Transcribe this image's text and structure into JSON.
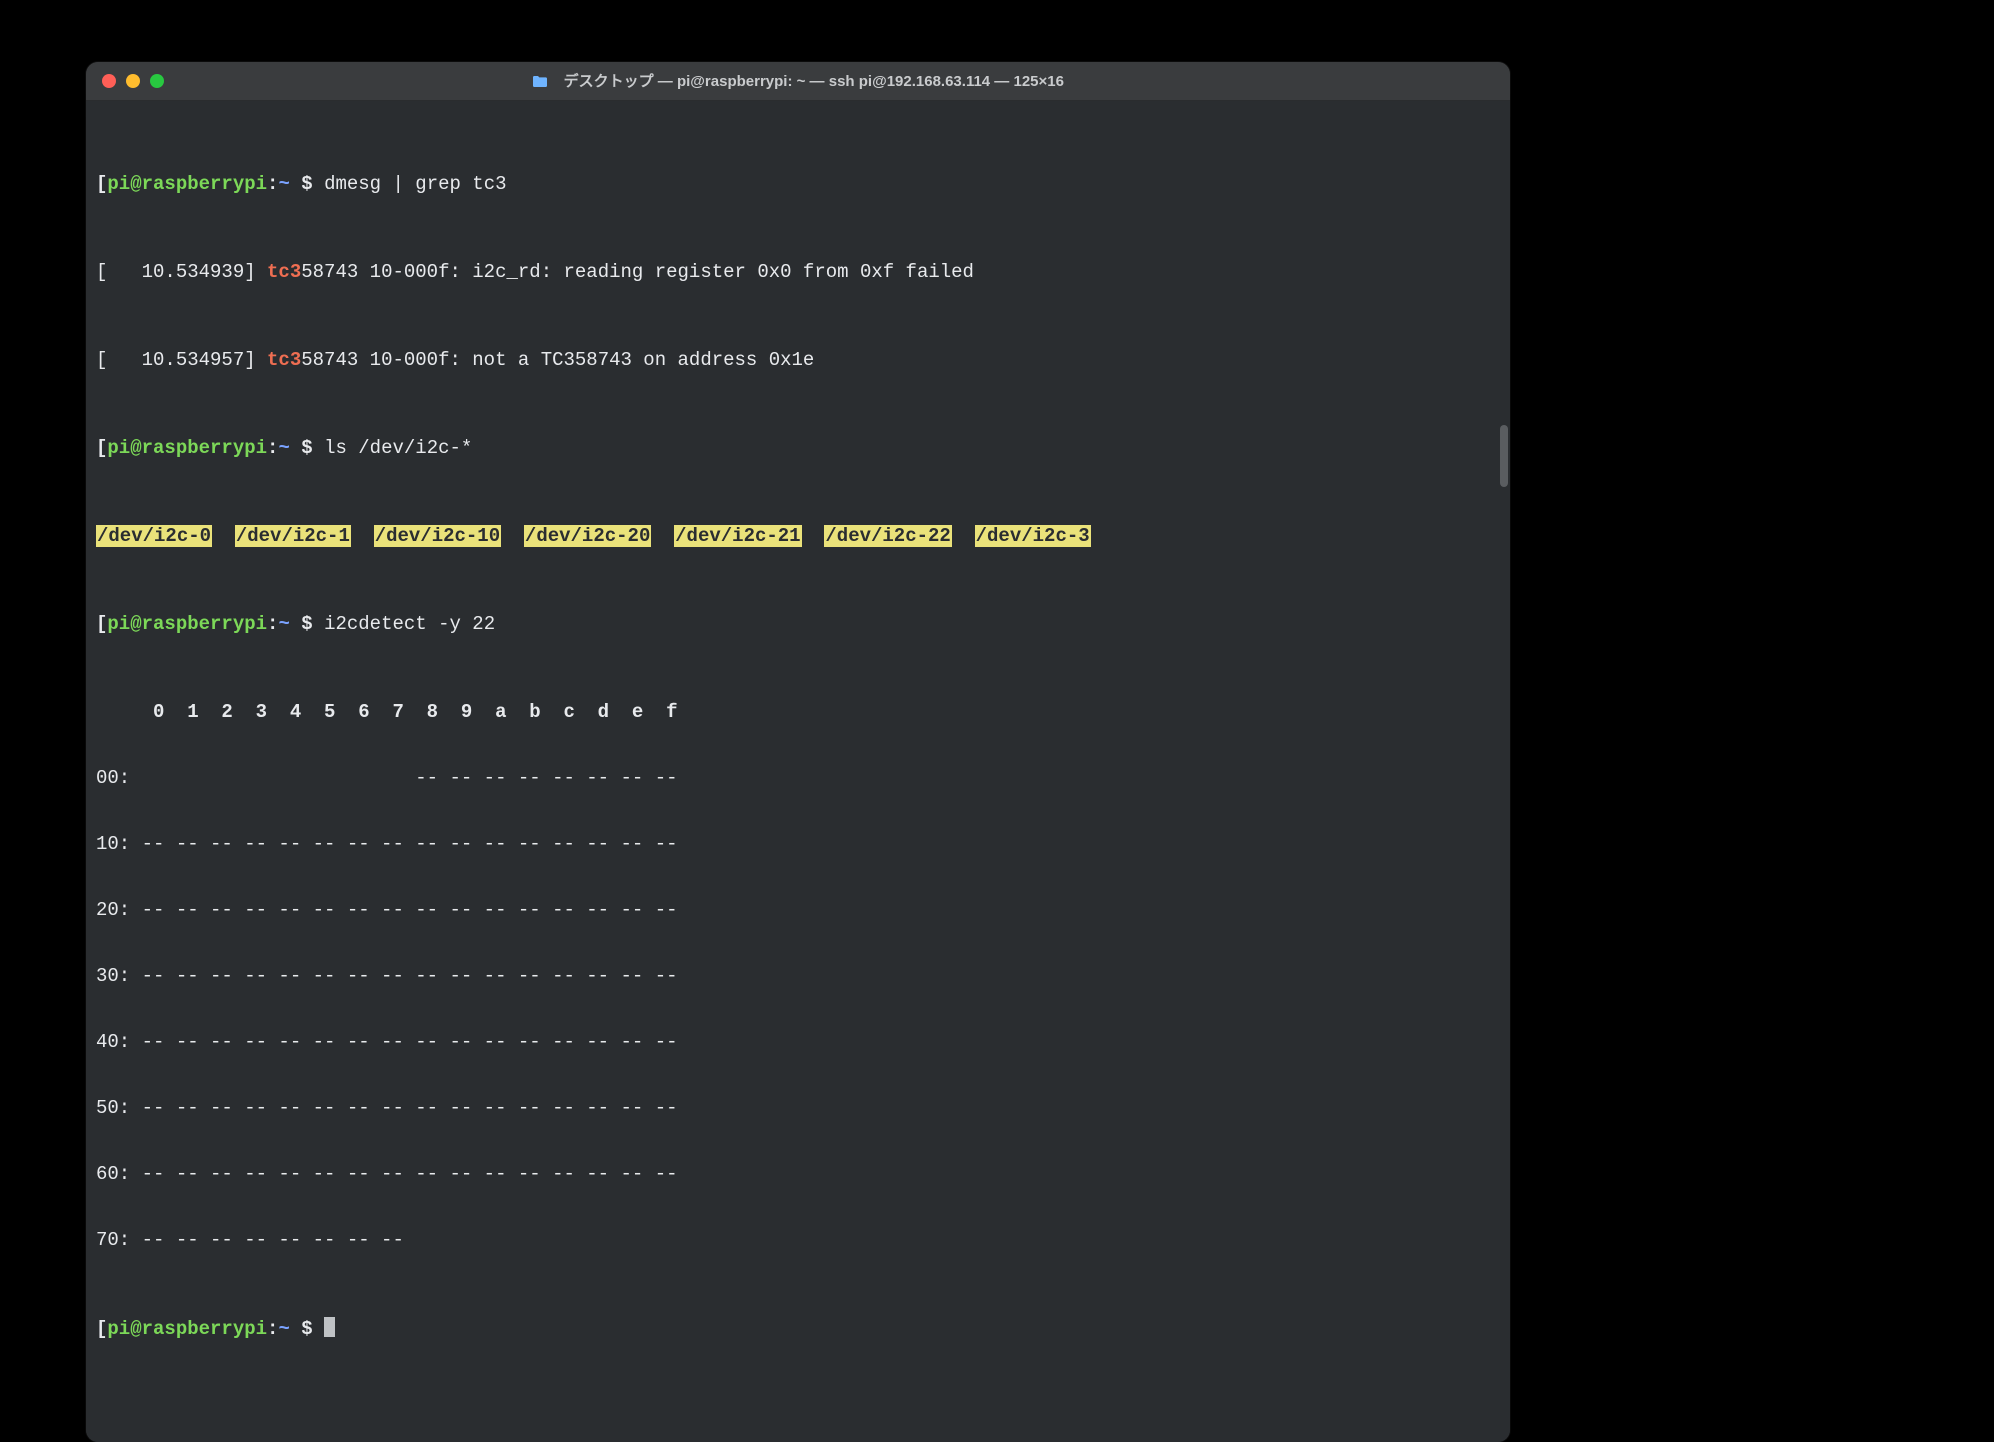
{
  "window": {
    "title": "デスクトップ — pi@raspberrypi: ~ — ssh pi@192.168.63.114 — 125×16"
  },
  "prompt": {
    "open": "[",
    "close": "]",
    "user_host": "pi@raspberrypi",
    "sep": ":",
    "path": "~",
    "dollar": " $ "
  },
  "commands": {
    "cmd1": "dmesg | grep tc3",
    "cmd2": "ls /dev/i2c-*",
    "cmd3": "i2cdetect -y 22"
  },
  "dmesg": {
    "l1_pre": "[   10.534939] ",
    "l1_tc": "tc3",
    "l1_rest": "58743 10-000f: i2c_rd: reading register 0x0 from 0xf failed",
    "l2_pre": "[   10.534957] ",
    "l2_tc": "tc3",
    "l2_rest": "58743 10-000f: not a TC358743 on address 0x1e"
  },
  "ls": {
    "d0": "/dev/i2c-0",
    "d1": "/dev/i2c-1",
    "d10": "/dev/i2c-10",
    "d20": "/dev/i2c-20",
    "d21": "/dev/i2c-21",
    "d22": "/dev/i2c-22",
    "d3": "/dev/i2c-3",
    "gap": "  "
  },
  "i2c": {
    "header": "     0  1  2  3  4  5  6  7  8  9  a  b  c  d  e  f",
    "r00": "00:                         -- -- -- -- -- -- -- -- ",
    "r10": "10: -- -- -- -- -- -- -- -- -- -- -- -- -- -- -- -- ",
    "r20": "20: -- -- -- -- -- -- -- -- -- -- -- -- -- -- -- -- ",
    "r30": "30: -- -- -- -- -- -- -- -- -- -- -- -- -- -- -- -- ",
    "r40": "40: -- -- -- -- -- -- -- -- -- -- -- -- -- -- -- -- ",
    "r50": "50: -- -- -- -- -- -- -- -- -- -- -- -- -- -- -- -- ",
    "r60": "60: -- -- -- -- -- -- -- -- -- -- -- -- -- -- -- -- ",
    "r70": "70: -- -- -- -- -- -- -- --                         "
  },
  "scrollbar": {
    "top_px": "320",
    "height_px": "62"
  }
}
